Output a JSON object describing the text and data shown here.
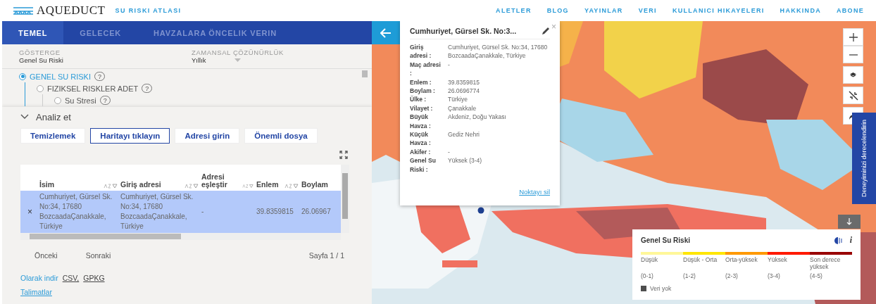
{
  "header": {
    "logo": "AQUEDUCT",
    "subtitle": "SU RISKI ATLASI",
    "nav": [
      "ALETLER",
      "BLOG",
      "YAYINLAR",
      "VERI",
      "KULLANICI HIKAYELERI",
      "HAKKINDA",
      "ABONE"
    ]
  },
  "tabs": [
    {
      "label": "TEMEL",
      "selected": true
    },
    {
      "label": "GELECEK",
      "selected": false
    },
    {
      "label": "HAVZALARA ÖNCELIK VERIN",
      "selected": false
    }
  ],
  "indicator": {
    "label": "GÖSTERGE",
    "value": "Genel Su Riski"
  },
  "resolution": {
    "label": "ZAMANSAL ÇÖZÜNÜRLÜK",
    "value": "Yıllık"
  },
  "layers": [
    {
      "label": "GENEL SU RISKI",
      "selected": true,
      "help": "?",
      "children": [
        {
          "label": "FIZIKSEL RISKLER ADET",
          "selected": false,
          "help": "?",
          "children": [
            {
              "label": "Su Stresi",
              "selected": false,
              "help": "?"
            }
          ]
        }
      ]
    }
  ],
  "analysis": {
    "title": "Analiz et",
    "expanded": true,
    "buttons": [
      {
        "label": "Temizlemek",
        "selected": false
      },
      {
        "label": "Haritayı tıklayın",
        "selected": true
      },
      {
        "label": "Adresi girin",
        "selected": false
      },
      {
        "label": "Önemli dosya",
        "selected": false
      }
    ],
    "table": {
      "columns": [
        "İsim",
        "Giriş adresi",
        "Adresi eşleştir",
        "Enlem",
        "Boylam"
      ],
      "rows": [
        {
          "selected": true,
          "remove": "×",
          "cells": [
            "Cumhuriyet, Gürsel Sk. No:34, 17680 BozcaadaÇanakkale, Türkiye",
            "Cumhuriyet, Gürsel Sk. No:34, 17680 BozcaadaÇanakkale, Türkiye",
            "-",
            "39.8359815",
            "26.06967"
          ]
        }
      ]
    },
    "pagination": {
      "prev": "Önceki",
      "next": "Sonraki",
      "page": "Sayfa 1 / 1"
    },
    "download": {
      "label": "Olarak indir",
      "formats": [
        "CSV,",
        "GPKG"
      ]
    },
    "instructions": "Talimatlar"
  },
  "popup": {
    "title": "Cumhuriyet, Gürsel Sk. No:3...",
    "close": "×",
    "fields": [
      {
        "label": "Giriş adresi :",
        "value": "Cumhuriyet, Gürsel Sk. No:34, 17680 BozcaadaÇanakkale, Türkiye"
      },
      {
        "label": "Maç adresi :",
        "value": "-"
      },
      {
        "label": "Enlem :",
        "value": "39.8359815"
      },
      {
        "label": "Boylam :",
        "value": "26.0696774"
      },
      {
        "label": "Ülke :",
        "value": "Türkiye"
      },
      {
        "label": "Vilayet :",
        "value": "Çanakkale"
      },
      {
        "label": "Büyük Havza :",
        "value": "Akdeniz, Doğu Yakası"
      },
      {
        "label": "Küçük Havza :",
        "value": "Gediz Nehri"
      },
      {
        "label": "Akifer :",
        "value": "-"
      },
      {
        "label": "Genel Su Riski :",
        "value": "Yüksek (3-4)"
      }
    ],
    "action": "Noktayı sil"
  },
  "rating_tab": "Deneyiminizi derecelendirin",
  "legend": {
    "title": "Genel Su Riski",
    "info": "i",
    "classes": [
      {
        "label": "Düşük",
        "range": "(0-1)",
        "color": "#fff799"
      },
      {
        "label": "Düşük - Orta",
        "range": "(1-2)",
        "color": "#ffe600"
      },
      {
        "label": "Orta-yüksek",
        "range": "(2-3)",
        "color": "#ff9900"
      },
      {
        "label": "Yüksek",
        "range": "(3-4)",
        "color": "#ff1900"
      },
      {
        "label": "Son derece yüksek",
        "range": "(4-5)",
        "color": "#990000"
      }
    ],
    "no_data": "Veri yok"
  }
}
